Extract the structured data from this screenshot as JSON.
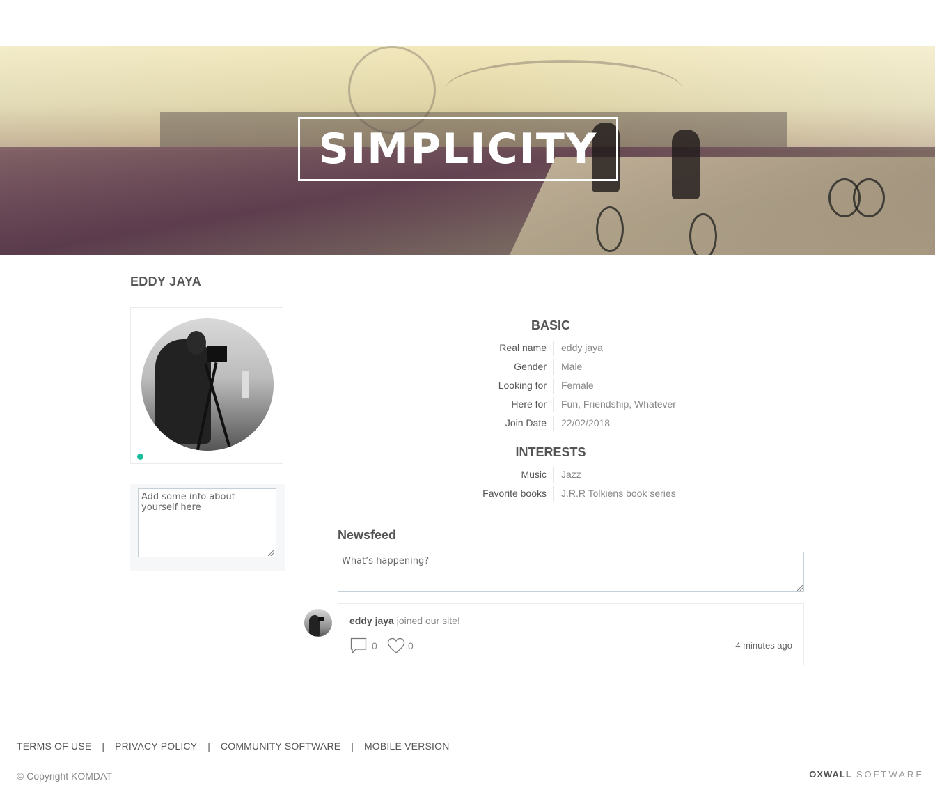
{
  "banner": {
    "title": "SIMPLICITY"
  },
  "profile": {
    "display_name": "EDDY JAYA",
    "online": true,
    "about_placeholder": "Add some info about yourself here"
  },
  "sections": {
    "basic": {
      "heading": "BASIC",
      "fields": [
        {
          "label": "Real name",
          "value": "eddy jaya"
        },
        {
          "label": "Gender",
          "value": "Male"
        },
        {
          "label": "Looking for",
          "value": "Female"
        },
        {
          "label": "Here for",
          "value": "Fun, Friendship, Whatever"
        },
        {
          "label": "Join Date",
          "value": "22/02/2018"
        }
      ]
    },
    "interests": {
      "heading": "INTERESTS",
      "fields": [
        {
          "label": "Music",
          "value": "Jazz"
        },
        {
          "label": "Favorite books",
          "value": "J.R.R Tolkiens book series"
        }
      ]
    }
  },
  "newsfeed": {
    "heading": "Newsfeed",
    "status_placeholder": "What’s happening?",
    "items": [
      {
        "user": "eddy jaya",
        "action": "joined our site!",
        "comments": "0",
        "likes": "0",
        "time": "4 minutes ago"
      }
    ]
  },
  "footer": {
    "links": [
      "TERMS OF USE",
      "PRIVACY POLICY",
      "COMMUNITY SOFTWARE",
      "MOBILE VERSION"
    ],
    "separator": "|",
    "copyright": "© Copyright KOMDAT",
    "brand_bold": "OXWALL",
    "brand_light": "SOFTWARE"
  },
  "colors": {
    "online": "#1abc9c",
    "text": "#555555",
    "muted": "#888888",
    "border": "#e8ecef"
  },
  "icons": [
    "comment-icon",
    "heart-icon"
  ]
}
